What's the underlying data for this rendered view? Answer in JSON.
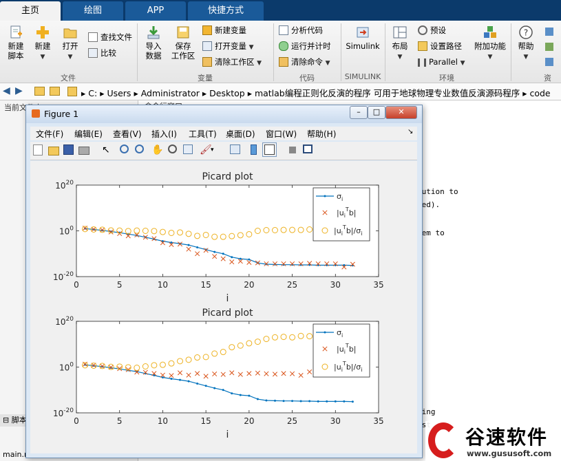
{
  "tabs": [
    {
      "label": "主页",
      "active": true
    },
    {
      "label": "绘图",
      "active": false
    },
    {
      "label": "APP",
      "active": false
    },
    {
      "label": "快捷方式",
      "active": false
    }
  ],
  "ribbon": {
    "file": {
      "new_script": "新建\n脚本",
      "new": "新建",
      "open": "打开",
      "find_files": "查找文件",
      "compare": "比较",
      "group": "文件"
    },
    "variable": {
      "import": "导入\n数据",
      "save_ws": "保存\n工作区",
      "new_var": "新建变量",
      "open_var": "打开变量",
      "clear_ws": "清除工作区",
      "group": "变量"
    },
    "code": {
      "analyze": "分析代码",
      "run_time": "运行并计时",
      "clear_cmd": "清除命令",
      "group": "代码"
    },
    "simulink": {
      "label": "Simulink",
      "group": "SIMULINK"
    },
    "env": {
      "layout": "布局",
      "prefs": "预设",
      "set_path": "设置路径",
      "parallel": "Parallel",
      "addons": "附加功能",
      "group": "环境"
    },
    "help": {
      "label": "帮助",
      "group": "资"
    }
  },
  "address": {
    "path": [
      "C:",
      "Users",
      "Administrator",
      "Desktop",
      "matlab编程正则化反演的程序 可用于地球物理专业数值反演源码程序",
      "code"
    ]
  },
  "left_pane": {
    "title": "当前文件夹",
    "bottom_title": "脚本",
    "file": "main.m（脚本）"
  },
  "command_header": "命令行窗口",
  "code_lines": [
    "lution to",
    "ded).",
    "eem to",
    "ding",
    "est"
  ],
  "figure": {
    "title": "Figure 1",
    "menus": [
      "文件(F)",
      "编辑(E)",
      "查看(V)",
      "插入(I)",
      "工具(T)",
      "桌面(D)",
      "窗口(W)",
      "帮助(H)"
    ]
  },
  "chart_data": [
    {
      "type": "line",
      "title": "Picard plot",
      "xlabel": "i",
      "ylabel": "",
      "xlim": [
        0,
        35
      ],
      "ylim_log10": [
        -20,
        20
      ],
      "yscale": "log",
      "xticks": [
        0,
        5,
        10,
        15,
        20,
        25,
        30,
        35
      ],
      "yticks": [
        "10^-20",
        "10^0",
        "10^20"
      ],
      "legend": "top-right",
      "series": [
        {
          "name": "σ_i",
          "marker": "dot-line",
          "color": "#0072bd",
          "x": [
            1,
            2,
            3,
            4,
            5,
            6,
            7,
            8,
            9,
            10,
            11,
            12,
            13,
            14,
            15,
            16,
            17,
            18,
            19,
            20,
            21,
            22,
            23,
            24,
            25,
            26,
            27,
            28,
            29,
            30,
            31,
            32
          ],
          "log10": [
            1,
            0.6,
            0.2,
            -0.3,
            -0.8,
            -1.4,
            -2,
            -2.8,
            -3.6,
            -4.5,
            -5.1,
            -5.6,
            -6.2,
            -7.2,
            -8.2,
            -9.2,
            -10,
            -11.5,
            -12.2,
            -12.5,
            -14,
            -14.6,
            -14.7,
            -14.8,
            -14.8,
            -14.9,
            -14.9,
            -15,
            -15,
            -15,
            -15,
            -15.1
          ]
        },
        {
          "name": "|u_i^T b|",
          "marker": "x",
          "color": "#d95319",
          "x": [
            1,
            2,
            3,
            4,
            5,
            6,
            7,
            8,
            9,
            10,
            11,
            12,
            13,
            14,
            15,
            16,
            17,
            18,
            19,
            20,
            21,
            22,
            23,
            24,
            25,
            26,
            27,
            28,
            29,
            30,
            31,
            32
          ],
          "log10": [
            1.2,
            0.7,
            0.4,
            -0.5,
            -1.2,
            -2.2,
            -1.8,
            -2.8,
            -3.4,
            -5.2,
            -6,
            -5.8,
            -8,
            -10,
            -8.5,
            -11.2,
            -12.2,
            -13.6,
            -13.3,
            -13.8,
            -14,
            -14.4,
            -14.4,
            -14.4,
            -14.4,
            -14.4,
            -14.2,
            -14.4,
            -14.4,
            -14.4,
            -15.8,
            -14.6
          ]
        },
        {
          "name": "|u_i^T b|/σ_i",
          "marker": "o",
          "color": "#edb120",
          "x": [
            1,
            2,
            3,
            4,
            5,
            6,
            7,
            8,
            9,
            10,
            11,
            12,
            13,
            14,
            15,
            16,
            17,
            18,
            19,
            20,
            21,
            22,
            23,
            24,
            25,
            26,
            27,
            28,
            29,
            30,
            31,
            32
          ],
          "log10": [
            0.8,
            0.6,
            0.5,
            0.2,
            0.1,
            -0.1,
            0.1,
            0,
            -0.1,
            -0.5,
            -0.9,
            -0.7,
            -1.3,
            -2.2,
            -1.8,
            -2.6,
            -2.6,
            -2.3,
            -1.9,
            -1.5,
            0,
            0.3,
            0.3,
            0.4,
            0.4,
            0.4,
            0.6,
            0.5,
            0.5,
            0.6,
            -0.1,
            0.6
          ]
        }
      ]
    },
    {
      "type": "line",
      "title": "Picard plot",
      "xlabel": "i",
      "ylabel": "",
      "xlim": [
        0,
        35
      ],
      "ylim_log10": [
        -20,
        20
      ],
      "yscale": "log",
      "xticks": [
        0,
        5,
        10,
        15,
        20,
        25,
        30,
        35
      ],
      "yticks": [
        "10^-20",
        "10^0",
        "10^20"
      ],
      "legend": "top-right",
      "series": [
        {
          "name": "σ_i",
          "marker": "dot-line",
          "color": "#0072bd",
          "x": [
            1,
            2,
            3,
            4,
            5,
            6,
            7,
            8,
            9,
            10,
            11,
            12,
            13,
            14,
            15,
            16,
            17,
            18,
            19,
            20,
            21,
            22,
            23,
            24,
            25,
            26,
            27,
            28,
            29,
            30,
            31,
            32
          ],
          "log10": [
            1,
            0.6,
            0.2,
            -0.3,
            -0.8,
            -1.4,
            -2,
            -2.8,
            -3.6,
            -4.5,
            -5.1,
            -5.6,
            -6.2,
            -7.2,
            -8.2,
            -9.2,
            -10,
            -11.5,
            -12.2,
            -12.5,
            -14,
            -14.6,
            -14.7,
            -14.8,
            -14.8,
            -14.9,
            -14.9,
            -15,
            -15,
            -15,
            -15,
            -15.1
          ]
        },
        {
          "name": "|u_i^T b|",
          "marker": "x",
          "color": "#d95319",
          "x": [
            1,
            2,
            3,
            4,
            5,
            6,
            7,
            8,
            9,
            10,
            11,
            12,
            13,
            14,
            15,
            16,
            17,
            18,
            19,
            20,
            21,
            22,
            23,
            24,
            25,
            26,
            27,
            28,
            29,
            30,
            31,
            32
          ],
          "log10": [
            1.3,
            0.8,
            0.4,
            -0.1,
            -0.7,
            -1.1,
            -2.2,
            -2.3,
            -2.8,
            -3.5,
            -3.7,
            -2.5,
            -3.5,
            -2.8,
            -4,
            -3,
            -3.2,
            -2.5,
            -3.2,
            -2.8,
            -2.6,
            -2.9,
            -3.1,
            -2.8,
            -2.9,
            -3.6,
            -2.1,
            -2.4,
            -2.6,
            -2.4,
            -3.2,
            -2.6
          ]
        },
        {
          "name": "|u_i^T b|/σ_i",
          "marker": "o",
          "color": "#edb120",
          "x": [
            1,
            2,
            3,
            4,
            5,
            6,
            7,
            8,
            9,
            10,
            11,
            12,
            13,
            14,
            15,
            16,
            17,
            18,
            19,
            20,
            21,
            22,
            23,
            24,
            25,
            26,
            27,
            28,
            29,
            30,
            31,
            32
          ],
          "log10": [
            0.8,
            0.6,
            0.5,
            0.1,
            0.2,
            -0.1,
            -0.3,
            0.3,
            0.8,
            1,
            1.6,
            2.6,
            3.2,
            4.2,
            4.4,
            5.9,
            6.6,
            8.7,
            9.4,
            10.4,
            11.1,
            12.3,
            13,
            13.2,
            13,
            13.6,
            13.5,
            13.3,
            13.2,
            12.9,
            12,
            12.4
          ]
        }
      ]
    }
  ],
  "watermark": {
    "brand": "谷速软件",
    "url": "www.gususoft.com"
  }
}
